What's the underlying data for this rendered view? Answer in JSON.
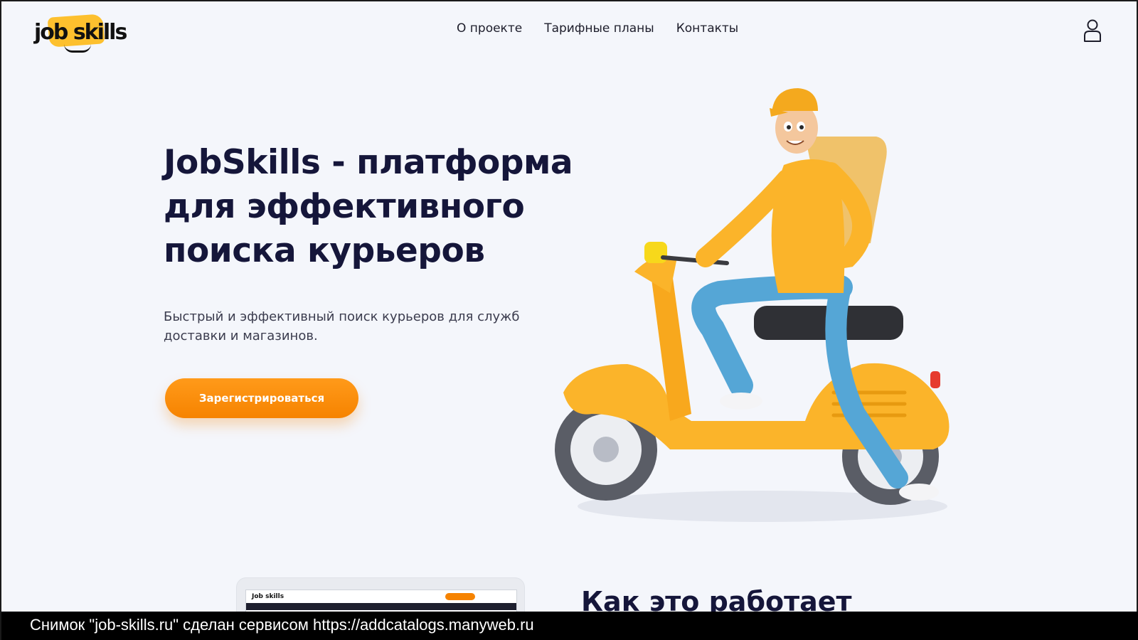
{
  "header": {
    "logo_text": "job skills",
    "nav": [
      {
        "label": "О проекте"
      },
      {
        "label": "Тарифные планы"
      },
      {
        "label": "Контакты"
      }
    ],
    "user_icon": "user-icon"
  },
  "hero": {
    "title": "JobSkills - платформа для эффективного поиска курьеров",
    "subtitle": "Быстрый и эффективный поиск курьеров  для служб доставки и магазинов.",
    "cta_label": "Зарегистрироваться",
    "illustration": "courier-on-scooter"
  },
  "how_it_works": {
    "title": "Как это работает",
    "mockup_logo": "Job skills"
  },
  "caption": "Снимок \"job-skills.ru\" сделан сервисом https://addcatalogs.manyweb.ru",
  "colors": {
    "accent": "#f68300",
    "brand_yellow": "#fdc02e",
    "title": "#15163a",
    "background": "#f4f6fb"
  }
}
